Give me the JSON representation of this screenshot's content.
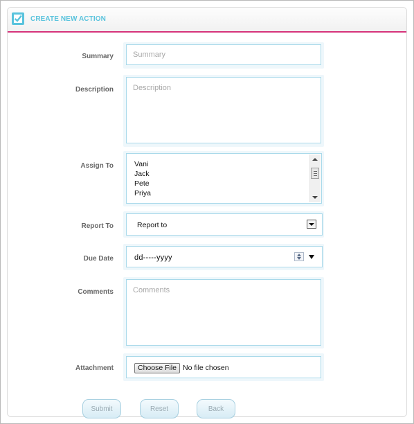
{
  "header": {
    "title": "CREATE NEW ACTION",
    "icon": "check-box-icon"
  },
  "form": {
    "summary": {
      "label": "Summary",
      "placeholder": "Summary",
      "value": ""
    },
    "description": {
      "label": "Description",
      "placeholder": "Description",
      "value": ""
    },
    "assign_to": {
      "label": "Assign To",
      "options": [
        "Vani",
        "Jack",
        "Pete",
        "Priya"
      ]
    },
    "report_to": {
      "label": "Report To",
      "selected": "Report to"
    },
    "due_date": {
      "label": "Due Date",
      "value": "dd-----yyyy"
    },
    "comments": {
      "label": "Comments",
      "placeholder": "Comments",
      "value": ""
    },
    "attachment": {
      "label": "Attachment",
      "button": "Choose File",
      "status": "No file chosen"
    }
  },
  "buttons": {
    "submit": "Submit",
    "reset": "Reset",
    "back": "Back"
  },
  "colors": {
    "accent": "#59c3dd",
    "header_rule": "#d6337a",
    "field_border": "#a9d9ea"
  }
}
